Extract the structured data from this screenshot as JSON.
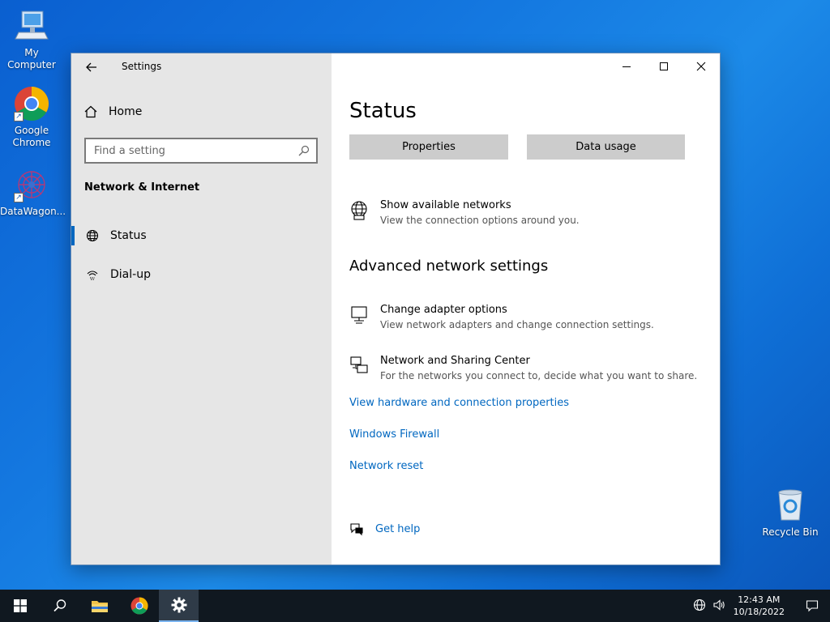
{
  "desktop": {
    "icons": [
      {
        "label": "My Computer"
      },
      {
        "label": "Google Chrome"
      },
      {
        "label": "DataWagon..."
      },
      {
        "label": "Recycle Bin"
      }
    ]
  },
  "window": {
    "title": "Settings",
    "sidebar": {
      "home_label": "Home",
      "search_placeholder": "Find a setting",
      "section_title": "Network & Internet",
      "items": [
        {
          "label": "Status",
          "icon": "globe-icon",
          "active": true
        },
        {
          "label": "Dial-up",
          "icon": "dialup-icon",
          "active": false
        }
      ]
    },
    "content": {
      "title": "Status",
      "buttons": {
        "properties": "Properties",
        "data_usage": "Data usage"
      },
      "show_networks": {
        "title": "Show available networks",
        "desc": "View the connection options around you."
      },
      "advanced_title": "Advanced network settings",
      "adapter": {
        "title": "Change adapter options",
        "desc": "View network adapters and change connection settings."
      },
      "sharing": {
        "title": "Network and Sharing Center",
        "desc": "For the networks you connect to, decide what you want to share."
      },
      "links": {
        "hardware": "View hardware and connection properties",
        "firewall": "Windows Firewall",
        "reset": "Network reset",
        "help": "Get help"
      }
    }
  },
  "taskbar": {
    "time": "12:43 AM",
    "date": "10/18/2022"
  },
  "colors": {
    "accent": "#0067c0",
    "sidebar_bg": "#e6e6e6",
    "taskbar_bg": "#101820"
  }
}
